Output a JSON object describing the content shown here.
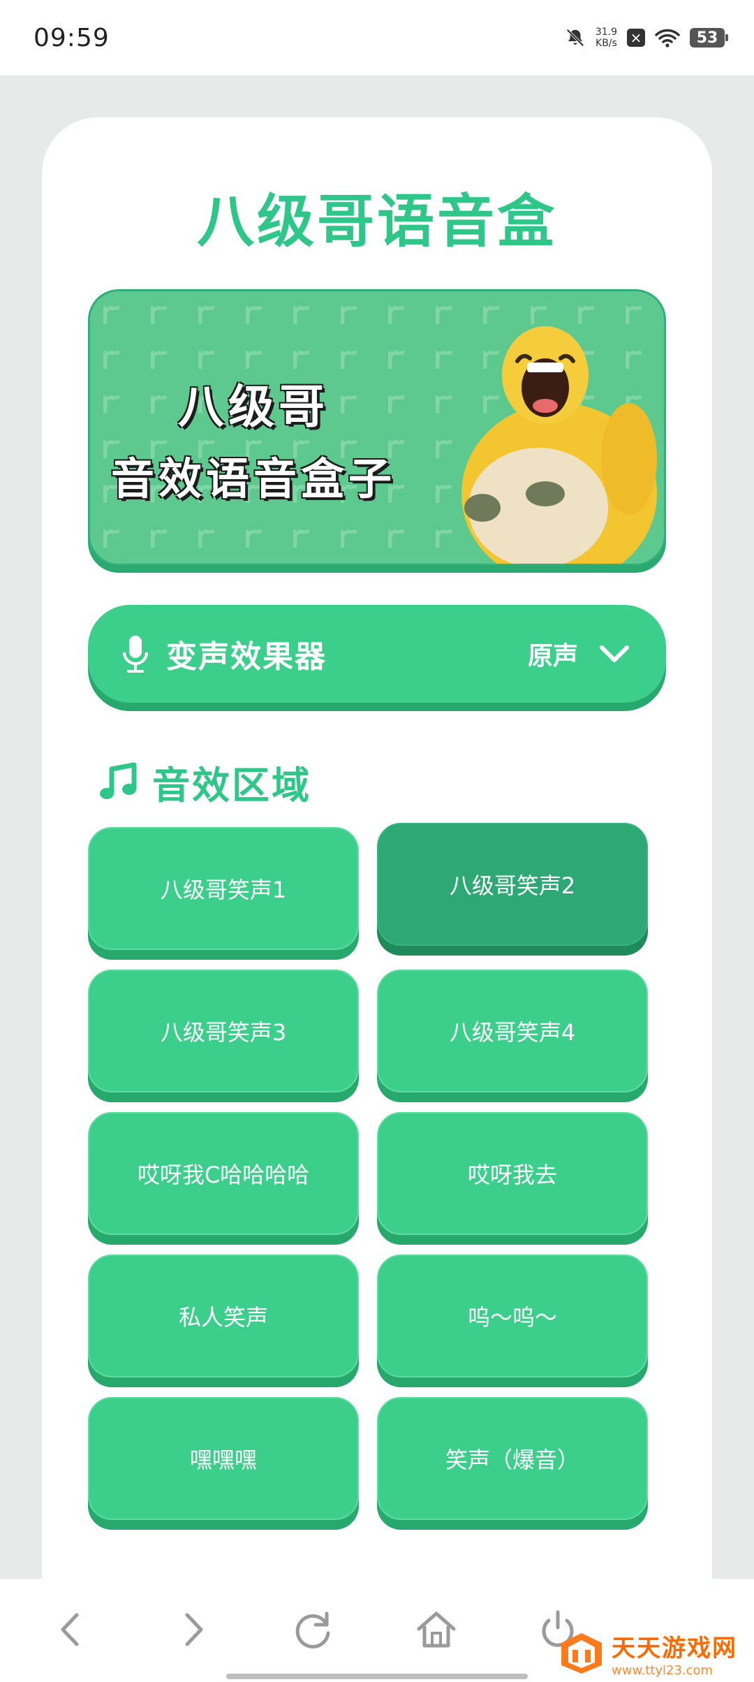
{
  "status": {
    "time": "09:59",
    "speed": "31.9",
    "speed_unit": "KB/s",
    "battery": "53"
  },
  "app": {
    "title": "八级哥语音盒"
  },
  "banner": {
    "line1": "八级哥",
    "line2": "音效语音盒子"
  },
  "voice_changer": {
    "label": "变声效果器",
    "value": "原声"
  },
  "section": {
    "title": "音效区域"
  },
  "sounds": [
    {
      "label": "八级哥笑声1",
      "active": false
    },
    {
      "label": "八级哥笑声2",
      "active": true
    },
    {
      "label": "八级哥笑声3",
      "active": false
    },
    {
      "label": "八级哥笑声4",
      "active": false
    },
    {
      "label": "哎呀我C哈哈哈哈",
      "active": false
    },
    {
      "label": "哎呀我去",
      "active": false
    },
    {
      "label": "私人笑声",
      "active": false
    },
    {
      "label": "呜～呜～",
      "active": false
    },
    {
      "label": "嘿嘿嘿",
      "active": false
    },
    {
      "label": "笑声（爆音）",
      "active": false
    }
  ],
  "watermark": {
    "name": "天天游戏网",
    "url": "www.ttyl23.com"
  },
  "colors": {
    "accent": "#2fc68a",
    "button": "#3ccf8c",
    "button_active": "#2ea875"
  },
  "icons": {
    "mic": "microphone-icon",
    "chevron": "chevron-down-icon",
    "note": "music-note-icon",
    "nav": [
      "back-icon",
      "forward-icon",
      "refresh-icon",
      "home-icon",
      "power-icon"
    ]
  }
}
